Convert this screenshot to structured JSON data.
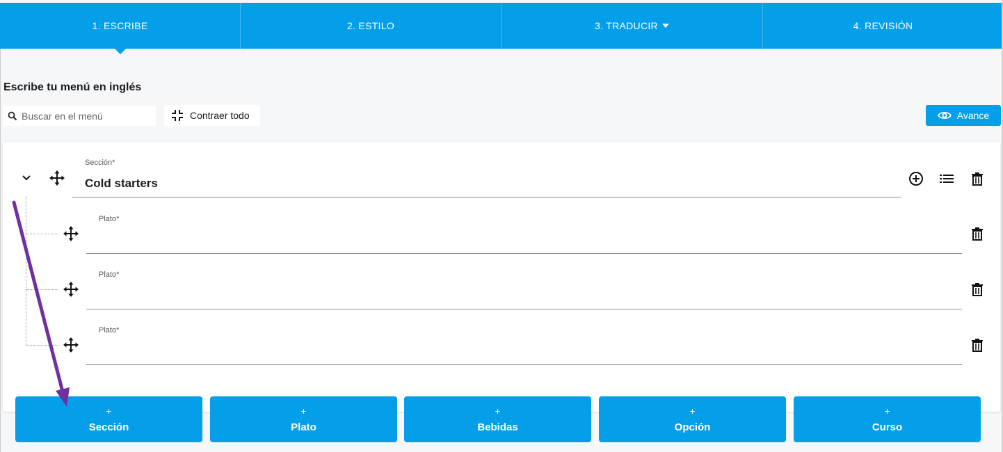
{
  "tabs": [
    {
      "label": "1. ESCRIBE",
      "active": true
    },
    {
      "label": "2. ESTILO"
    },
    {
      "label": "3. TRADUCIR",
      "has_dropdown": true
    },
    {
      "label": "4. REVISIÓN"
    }
  ],
  "page_title": "Escribe tu menú en inglés",
  "toolbar": {
    "search_placeholder": "Buscar en el menú",
    "collapse_label": "Contraer todo",
    "preview_label": "Avance"
  },
  "section": {
    "field_label": "Sección*",
    "value": "Cold starters",
    "dishes": [
      {
        "field_label": "Plato*",
        "value": ""
      },
      {
        "field_label": "Plato*",
        "value": ""
      },
      {
        "field_label": "Plato*",
        "value": ""
      }
    ]
  },
  "add_buttons": [
    {
      "plus": "+",
      "label": "Sección"
    },
    {
      "plus": "+",
      "label": "Plato"
    },
    {
      "plus": "+",
      "label": "Bebidas"
    },
    {
      "plus": "+",
      "label": "Opción"
    },
    {
      "plus": "+",
      "label": "Curso"
    }
  ],
  "colors": {
    "accent": "#049fe8",
    "annotation_arrow": "#7030a0",
    "background": "#f6f7f9"
  },
  "icons": {
    "search": "search-icon",
    "collapse": "collapse-icon",
    "preview": "eye-icon",
    "expand": "chevron-down-icon",
    "drag": "move-icon",
    "add": "plus-circle-icon",
    "list": "list-icon",
    "delete": "trash-icon"
  }
}
